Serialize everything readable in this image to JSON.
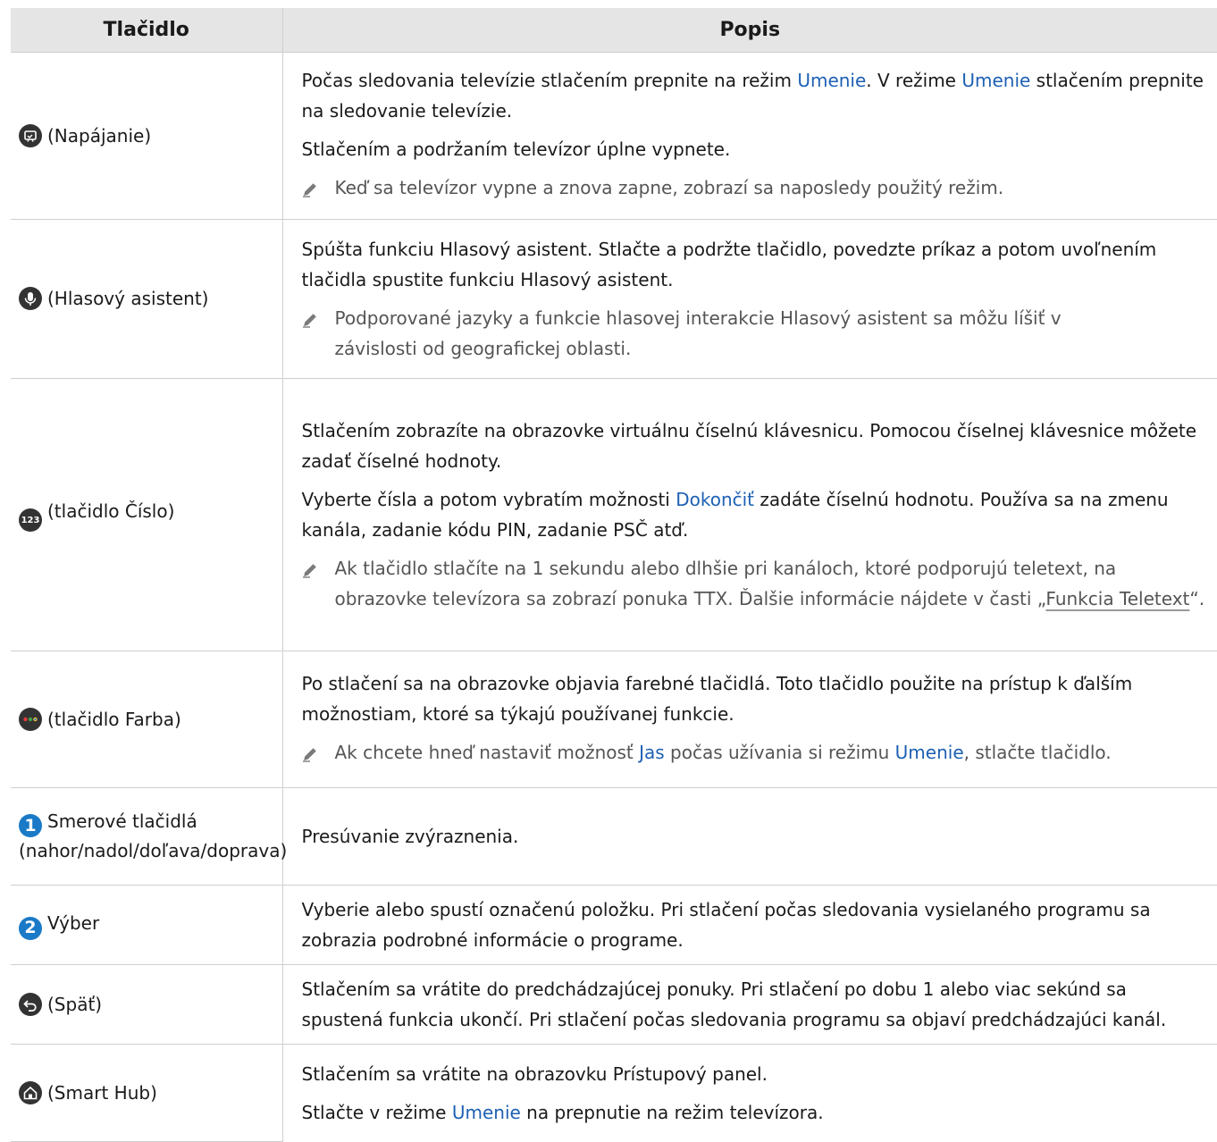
{
  "headers": {
    "button": "Tlačidlo",
    "description": "Popis"
  },
  "rows": [
    {
      "button": "(Napájanie)",
      "icon": "tv-art-power-icon",
      "p1": [
        "Počas sledovania televízie stlačením prepnite na režim ",
        "Umenie",
        ". V režime ",
        "Umenie",
        " stlačením prepnite na sledovanie televízie."
      ],
      "p2": "Stlačením a podržaním televízor úplne vypnete.",
      "note": "Keď sa televízor vypne a znova zapne, zobrazí sa naposledy použitý režim."
    },
    {
      "button": "(Hlasový asistent)",
      "icon": "microphone-icon",
      "p1": "Spúšta funkciu Hlasový asistent. Stlačte a podržte tlačidlo, povedzte príkaz a potom uvoľnením tlačidla spustite funkciu Hlasový asistent.",
      "note": "Podporované jazyky a funkcie hlasovej interakcie Hlasový asistent sa môžu líšiť v závislosti od geografickej oblasti."
    },
    {
      "button": "(tlačidlo Číslo)",
      "icon": "number-123-icon",
      "icon_text": "123",
      "p1": "Stlačením zobrazíte na obrazovke virtuálnu číselnú klávesnicu. Pomocou číselnej klávesnice môžete zadať číselné hodnoty.",
      "p2": [
        "Vyberte čísla a potom vybratím možnosti ",
        "Dokončiť",
        " zadáte číselnú hodnotu. Používa sa na zmenu kanála, zadanie kódu PIN, zadanie PSČ atď."
      ],
      "note": [
        "Ak tlačidlo stlačíte na 1 sekundu alebo dlhšie pri kanáloch, ktoré podporujú teletext, na obrazovke televízora sa zobrazí ponuka TTX. Ďalšie informácie nájdete v časti „",
        "Funkcia Teletext",
        "“."
      ]
    },
    {
      "button": "(tlačidlo Farba)",
      "icon": "color-button-icon",
      "p1": "Po stlačení sa na obrazovke objavia farebné tlačidlá. Toto tlačidlo použite na prístup k ďalším možnostiam, ktoré sa týkajú používanej funkcie.",
      "note": [
        "Ak chcete hneď nastaviť možnosť ",
        "Jas",
        " počas užívania si režimu ",
        "Umenie",
        ", stlačte tlačidlo."
      ]
    },
    {
      "number": "1",
      "button": "Smerové tlačidlá (nahor/nadol/doľava/doprava)",
      "p1": "Presúvanie zvýraznenia."
    },
    {
      "number": "2",
      "button": "Výber",
      "p1": "Vyberie alebo spustí označenú položku. Pri stlačení počas sledovania vysielaného programu sa zobrazia podrobné informácie o programe."
    },
    {
      "button": "(Späť)",
      "icon": "back-icon",
      "p1": "Stlačením sa vrátite do predchádzajúcej ponuky. Pri stlačení po dobu 1 alebo viac sekúnd sa spustená funkcia ukončí. Pri stlačení počas sledovania programu sa objaví predchádzajúci kanál."
    },
    {
      "button": "(Smart Hub)",
      "icon": "home-icon",
      "p1": "Stlačením sa vrátite na obrazovku Prístupový panel.",
      "p2": [
        "Stlačte v režime ",
        "Umenie",
        " na prepnutie na režim televízora."
      ]
    }
  ]
}
